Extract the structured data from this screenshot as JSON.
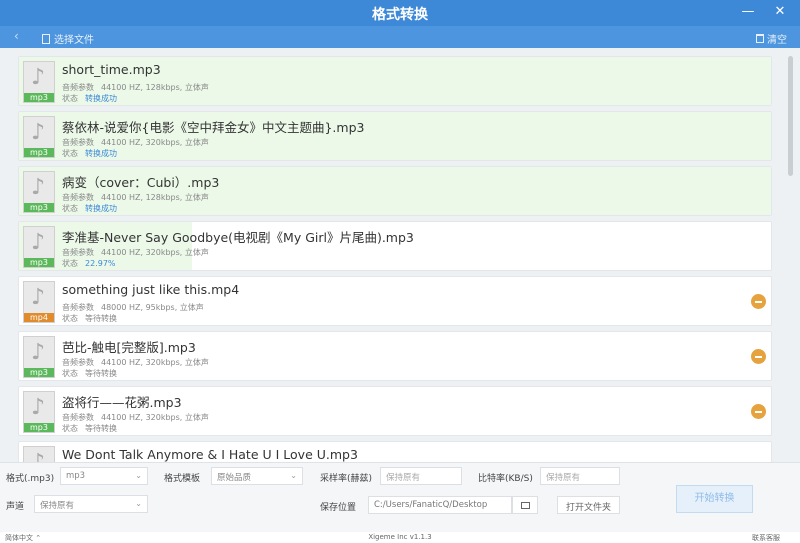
{
  "window": {
    "title": "格式转换",
    "minimize_icon": "minimize-icon",
    "close_icon": "close-icon"
  },
  "toolbar": {
    "back_icon": "chevron-left-icon",
    "select_file": "选择文件",
    "clear": "清空"
  },
  "labels": {
    "audio_params": "音频参数",
    "status": "状态"
  },
  "files": [
    {
      "name": "short_time.mp3",
      "ext": "mp3",
      "params": "44100 HZ, 128kbps, 立体声",
      "status": "转换成功",
      "state": "done",
      "progress": 1.0
    },
    {
      "name": "蔡依林-说爱你{电影《空中拜金女》中文主题曲}.mp3",
      "ext": "mp3",
      "params": "44100 HZ, 320kbps, 立体声",
      "status": "转换成功",
      "state": "done",
      "progress": 1.0
    },
    {
      "name": "病变（cover：Cubi）.mp3",
      "ext": "mp3",
      "params": "44100 HZ, 128kbps, 立体声",
      "status": "转换成功",
      "state": "done",
      "progress": 1.0
    },
    {
      "name": "李准基-Never Say Goodbye(电视剧《My Girl》片尾曲).mp3",
      "ext": "mp3",
      "params": "44100 HZ, 320kbps, 立体声",
      "status": "22.97%",
      "state": "progress",
      "progress": 0.2297
    },
    {
      "name": "something just like this.mp4",
      "ext": "mp4",
      "params": "48000 HZ, 95kbps, 立体声",
      "status": "等待转换",
      "state": "waiting",
      "progress": 0
    },
    {
      "name": "芭比-触电[完整版].mp3",
      "ext": "mp3",
      "params": "44100 HZ, 320kbps, 立体声",
      "status": "等待转换",
      "state": "waiting",
      "progress": 0
    },
    {
      "name": "盗将行——花粥.mp3",
      "ext": "mp3",
      "params": "44100 HZ, 320kbps, 立体声",
      "status": "等待转换",
      "state": "waiting",
      "progress": 0
    },
    {
      "name": "We Dont Talk Anymore & I Hate U I Love U.mp3",
      "ext": "mp3",
      "params": "",
      "status": "",
      "state": "waiting",
      "progress": 0
    }
  ],
  "settings": {
    "format_label": "格式(.mp3)",
    "format_value": "mp3",
    "template_label": "格式模板",
    "template_value": "原始品质",
    "samplerate_label": "采样率(赫兹)",
    "samplerate_placeholder": "保持原有",
    "bitrate_label": "比特率(KB/S)",
    "bitrate_placeholder": "保持原有",
    "channel_label": "声道",
    "channel_value": "保持原有",
    "save_label": "保存位置",
    "save_path": "C:/Users/FanaticQ/Desktop",
    "open_folder": "打开文件夹",
    "start": "开始转换"
  },
  "statusbar": {
    "language": "简体中文",
    "version": "Xigeme Inc v1.1.3",
    "contact": "联系客服"
  },
  "colors": {
    "titlebar": "#3d89d7",
    "toolbar": "#4d95de",
    "done_bg": "#ecf9e9",
    "mp3_tag": "#5bb85b",
    "mp4_tag": "#e08b2c",
    "remove": "#e6a23c",
    "status_ok": "#3d89d7"
  }
}
